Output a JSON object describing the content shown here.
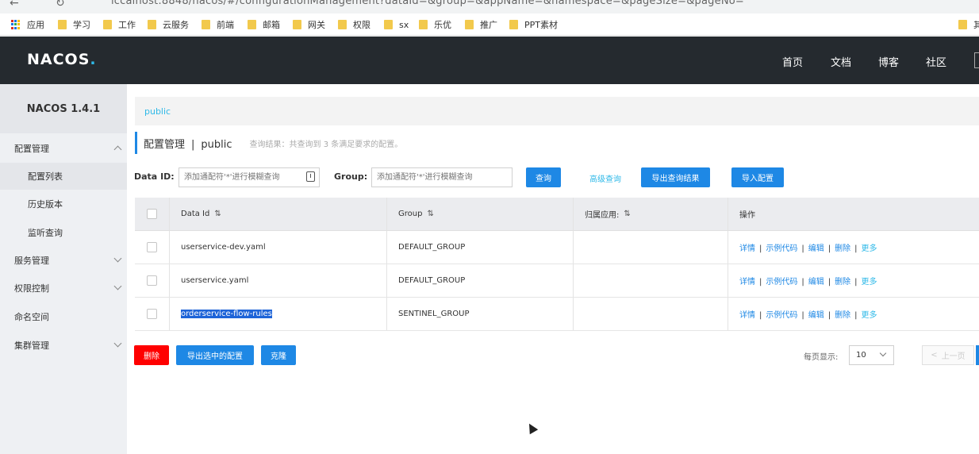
{
  "browser": {
    "url_fragment": "iccalhost:8848/nacos/#/configurationManagement?dataId=&group=&appName=&namespace=&pageSize=&pageNo=",
    "bookmarks": [
      {
        "label": "应用",
        "icon": "apps-grid-icon"
      },
      {
        "label": "学习",
        "icon": "folder-icon"
      },
      {
        "label": "工作",
        "icon": "folder-icon"
      },
      {
        "label": "云服务",
        "icon": "folder-icon"
      },
      {
        "label": "前端",
        "icon": "folder-icon"
      },
      {
        "label": "邮箱",
        "icon": "folder-icon"
      },
      {
        "label": "网关",
        "icon": "folder-icon"
      },
      {
        "label": "权限",
        "icon": "folder-icon"
      },
      {
        "label": "sx",
        "icon": "folder-icon"
      },
      {
        "label": "乐优",
        "icon": "folder-icon"
      },
      {
        "label": "推广",
        "icon": "folder-icon"
      },
      {
        "label": "PPT素材",
        "icon": "folder-icon"
      },
      {
        "label": "其",
        "icon": "folder-icon"
      }
    ]
  },
  "header": {
    "logo_main": "NACOS",
    "logo_dot": ".",
    "nav": [
      "首页",
      "文档",
      "博客",
      "社区"
    ]
  },
  "sidebar": {
    "title": "NACOS 1.4.1",
    "items": [
      {
        "label": "配置管理",
        "level": "parent",
        "expanded": true
      },
      {
        "label": "配置列表",
        "level": "child",
        "active": true
      },
      {
        "label": "历史版本",
        "level": "child"
      },
      {
        "label": "监听查询",
        "level": "child"
      },
      {
        "label": "服务管理",
        "level": "parent"
      },
      {
        "label": "权限控制",
        "level": "parent"
      },
      {
        "label": "命名空间",
        "level": "parent"
      },
      {
        "label": "集群管理",
        "level": "parent"
      }
    ]
  },
  "namespace_bar": {
    "current": "public"
  },
  "page": {
    "title": "配置管理",
    "separator": "|",
    "namespace": "public",
    "result_text": "查询结果：共查询到 3 条满足要求的配置。"
  },
  "filters": {
    "data_id_label": "Data ID:",
    "data_id_placeholder": "添加通配符'*'进行模糊查询",
    "group_label": "Group:",
    "group_placeholder": "添加通配符'*'进行模糊查询",
    "search_button": "查询",
    "advanced_link": "高级查询",
    "export_results_button": "导出查询结果",
    "import_button": "导入配置"
  },
  "table": {
    "columns": [
      "Data Id",
      "Group",
      "归属应用:",
      "操作"
    ],
    "sort_icon": "⇅",
    "rows": [
      {
        "data_id": "userservice-dev.yaml",
        "group": "DEFAULT_GROUP",
        "app": "",
        "selected_text": false
      },
      {
        "data_id": "userservice.yaml",
        "group": "DEFAULT_GROUP",
        "app": "",
        "selected_text": false
      },
      {
        "data_id": "orderservice-flow-rules",
        "group": "SENTINEL_GROUP",
        "app": "",
        "selected_text": true
      }
    ],
    "actions": [
      "详情",
      "示例代码",
      "编辑",
      "删除",
      "更多"
    ],
    "action_separator": "|"
  },
  "footer": {
    "delete_button": "删除",
    "export_selected_button": "导出选中的配置",
    "clone_button": "克隆",
    "per_page_label": "每页显示:",
    "per_page_value": "10",
    "prev_button": "上一页",
    "prev_arrow": "<"
  },
  "colors": {
    "header_bg": "#252a2f",
    "primary": "#1e88e5",
    "danger": "#ff0000",
    "link": "#2fb9e8"
  }
}
